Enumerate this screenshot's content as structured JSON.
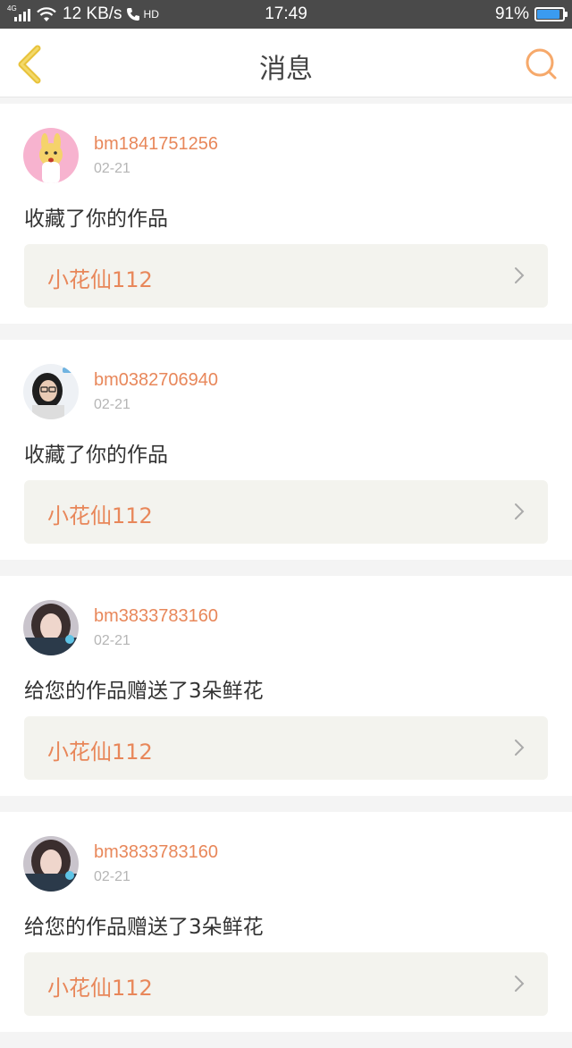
{
  "status_bar": {
    "network": "4G",
    "speed": "12 KB/s",
    "hd": "HD",
    "time": "17:49",
    "battery_text": "91%",
    "battery_level": 0.91,
    "battery_color": "#3a9bf0"
  },
  "header": {
    "title": "消息",
    "accent_color": "#f6a96b"
  },
  "messages": [
    {
      "username": "bm1841751256",
      "date": "02-21",
      "action": "收藏了你的作品",
      "work_title": "小花仙112",
      "avatar": "cartoon-bunny-avatar"
    },
    {
      "username": "bm0382706940",
      "date": "02-21",
      "action": "收藏了你的作品",
      "work_title": "小花仙112",
      "avatar": "girl-glasses-avatar"
    },
    {
      "username": "bm3833783160",
      "date": "02-21",
      "action": "给您的作品赠送了3朵鲜花",
      "work_title": "小花仙112",
      "avatar": "girl-photo-avatar"
    },
    {
      "username": "bm3833783160",
      "date": "02-21",
      "action": "给您的作品赠送了3朵鲜花",
      "work_title": "小花仙112",
      "avatar": "girl-photo-avatar"
    }
  ]
}
